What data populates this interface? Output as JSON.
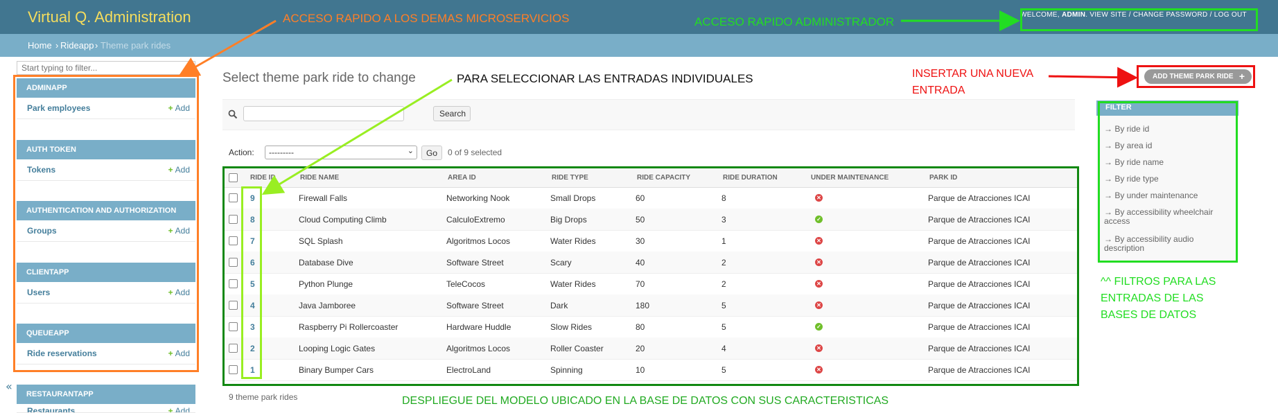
{
  "header": {
    "brand": "Virtual Q. Administration",
    "user_tools_prefix": "WELCOME, ",
    "user_name": "ADMIN",
    "user_links": ". VIEW SITE / CHANGE PASSWORD / LOG OUT",
    "background": "#417690",
    "brand_color": "#f5dd5d"
  },
  "breadcrumbs": {
    "home": "Home",
    "app": "Rideapp",
    "current": "Theme park rides",
    "separator": "›"
  },
  "sidebar": {
    "filter_placeholder": "Start typing to filter...",
    "collapse_glyph": "«",
    "add_label": "Add",
    "apps": [
      {
        "caption": "ADMINAPP",
        "model": "Park employees"
      },
      {
        "caption": "AUTH TOKEN",
        "model": "Tokens"
      },
      {
        "caption": "AUTHENTICATION AND AUTHORIZATION",
        "model": "Groups"
      },
      {
        "caption": "CLIENTAPP",
        "model": "Users"
      },
      {
        "caption": "QUEUEAPP",
        "model": "Ride reservations"
      },
      {
        "caption": "RESTAURANTAPP",
        "model": "Restaurants"
      }
    ]
  },
  "main": {
    "title": "Select theme park ride to change",
    "add_button": "ADD THEME PARK RIDE",
    "search_button": "Search",
    "action_label": "Action:",
    "action_selected": "---------",
    "go_button": "Go",
    "selection_count": "0 of 9 selected",
    "paginator": "9 theme park rides"
  },
  "table": {
    "columns": [
      "RIDE ID",
      "RIDE NAME",
      "AREA ID",
      "RIDE TYPE",
      "RIDE CAPACITY",
      "RIDE DURATION",
      "UNDER MAINTENANCE",
      "PARK ID"
    ],
    "rows": [
      {
        "id": "9",
        "name": "Firewall Falls",
        "area": "Networking Nook",
        "type": "Small Drops",
        "capacity": "60",
        "duration": "8",
        "maintenance": false,
        "park": "Parque de Atracciones ICAI"
      },
      {
        "id": "8",
        "name": "Cloud Computing Climb",
        "area": "CalculoExtremo",
        "type": "Big Drops",
        "capacity": "50",
        "duration": "3",
        "maintenance": true,
        "park": "Parque de Atracciones ICAI"
      },
      {
        "id": "7",
        "name": "SQL Splash",
        "area": "Algoritmos Locos",
        "type": "Water Rides",
        "capacity": "30",
        "duration": "1",
        "maintenance": false,
        "park": "Parque de Atracciones ICAI"
      },
      {
        "id": "6",
        "name": "Database Dive",
        "area": "Software Street",
        "type": "Scary",
        "capacity": "40",
        "duration": "2",
        "maintenance": false,
        "park": "Parque de Atracciones ICAI"
      },
      {
        "id": "5",
        "name": "Python Plunge",
        "area": "TeleCocos",
        "type": "Water Rides",
        "capacity": "70",
        "duration": "2",
        "maintenance": false,
        "park": "Parque de Atracciones ICAI"
      },
      {
        "id": "4",
        "name": "Java Jamboree",
        "area": "Software Street",
        "type": "Dark",
        "capacity": "180",
        "duration": "5",
        "maintenance": false,
        "park": "Parque de Atracciones ICAI"
      },
      {
        "id": "3",
        "name": "Raspberry Pi Rollercoaster",
        "area": "Hardware Huddle",
        "type": "Slow Rides",
        "capacity": "80",
        "duration": "5",
        "maintenance": true,
        "park": "Parque de Atracciones ICAI"
      },
      {
        "id": "2",
        "name": "Looping Logic Gates",
        "area": "Algoritmos Locos",
        "type": "Roller Coaster",
        "capacity": "20",
        "duration": "4",
        "maintenance": false,
        "park": "Parque de Atracciones ICAI"
      },
      {
        "id": "1",
        "name": "Binary Bumper Cars",
        "area": "ElectroLand",
        "type": "Spinning",
        "capacity": "10",
        "duration": "5",
        "maintenance": false,
        "park": "Parque de Atracciones ICAI"
      }
    ]
  },
  "filter": {
    "title": "FILTER",
    "items": [
      "→ By ride id",
      "→ By area id",
      "→ By ride name",
      "→ By ride type",
      "→ By under maintenance",
      "→ By accessibility wheelchair access",
      "→ By accessibility audio description"
    ]
  },
  "annotations": {
    "microservices": "ACCESO RAPIDO A LOS DEMAS MICROSERVICIOS",
    "admin_access": "ACCESO RAPIDO ADMINISTRADOR",
    "select_entries": "PARA SELECCIONAR LAS ENTRADAS INDIVIDUALES",
    "insert_line1": "INSERTAR UNA NUEVA",
    "insert_line2": "ENTRADA",
    "filters_line1": "^^ FILTROS PARA LAS",
    "filters_line2": "ENTRADAS DE LAS",
    "filters_line3": "BASES DE DATOS",
    "model_display": "DESPLIEGUE DEL MODELO UBICADO EN LA BASE DE DATOS CON SUS CARACTERISTICAS",
    "colors": {
      "orange": "#ff7f27",
      "green": "#22dd22",
      "red": "#ee1111",
      "lime": "#99ee22",
      "dark_green": "#118811"
    }
  }
}
